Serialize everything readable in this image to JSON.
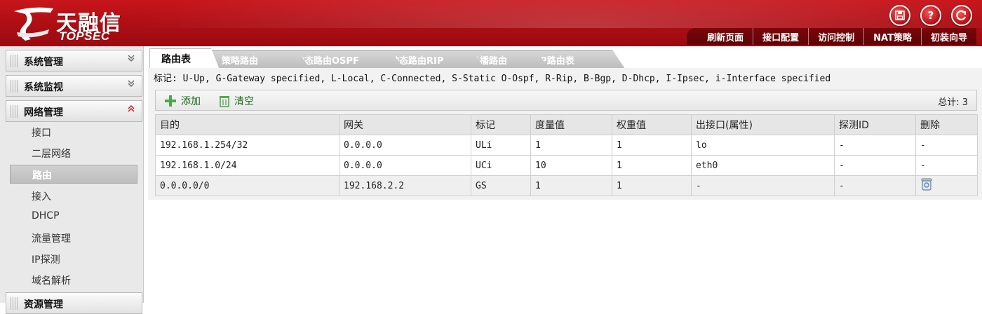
{
  "header": {
    "logo_cn": "天融信",
    "logo_en": "TOPSEC",
    "icons": [
      "save-icon",
      "help-icon",
      "logout-icon"
    ],
    "nav": [
      "刷新页面",
      "接口配置",
      "访问控制",
      "NAT策略",
      "初装向导"
    ]
  },
  "sidebar": {
    "sections": [
      {
        "label": "系统管理",
        "expanded": false
      },
      {
        "label": "系统监视",
        "expanded": false
      },
      {
        "label": "网络管理",
        "expanded": true
      },
      {
        "label": "资源管理",
        "expanded": false
      }
    ],
    "items": [
      "接口",
      "二层网络",
      "路由",
      "接入",
      "DHCP",
      "流量管理",
      "IP探测",
      "域名解析"
    ],
    "active_item": "路由"
  },
  "tabs": [
    "路由表",
    "策略路由",
    "动态路由OSPF",
    "动态路由RIP",
    "多播路由",
    "ISP路由表"
  ],
  "active_tab": "路由表",
  "legend": "标记: U-Up, G-Gateway specified, L-Local, C-Connected, S-Static O-Ospf, R-Rip, B-Bgp, D-Dhcp, I-Ipsec, i-Interface specified",
  "toolbar": {
    "add_label": "添加",
    "clear_label": "清空",
    "total": "总计: 3"
  },
  "table": {
    "headers": [
      "目的",
      "网关",
      "标记",
      "度量值",
      "权重值",
      "出接口(属性)",
      "探测ID",
      "删除"
    ],
    "rows": [
      {
        "dest": "192.168.1.254/32",
        "gateway": "0.0.0.0",
        "flag": "ULi",
        "metric": "1",
        "weight": "1",
        "iface": "lo",
        "probe": "-",
        "delete": "-"
      },
      {
        "dest": "192.168.1.0/24",
        "gateway": "0.0.0.0",
        "flag": "UCi",
        "metric": "10",
        "weight": "1",
        "iface": "eth0",
        "probe": "-",
        "delete": "-"
      },
      {
        "dest": "0.0.0.0/0",
        "gateway": "192.168.2.2",
        "flag": "GS",
        "metric": "1",
        "weight": "1",
        "iface": "-",
        "probe": "-",
        "delete": ""
      }
    ]
  },
  "colors": {
    "brand_red": "#b10f15",
    "nav_dark": "#5d0407",
    "add_green": "#1c6b1c"
  }
}
